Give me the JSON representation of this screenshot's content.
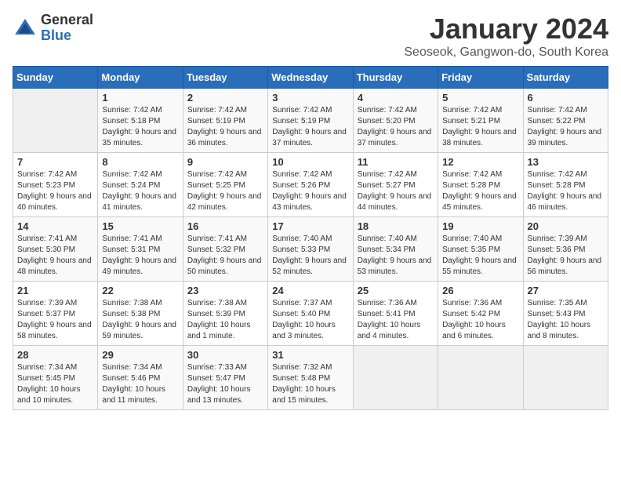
{
  "header": {
    "logo_general": "General",
    "logo_blue": "Blue",
    "month_title": "January 2024",
    "subtitle": "Seoseok, Gangwon-do, South Korea"
  },
  "days_of_week": [
    "Sunday",
    "Monday",
    "Tuesday",
    "Wednesday",
    "Thursday",
    "Friday",
    "Saturday"
  ],
  "weeks": [
    [
      {
        "day": "",
        "sunrise": "",
        "sunset": "",
        "daylight": "",
        "empty": true
      },
      {
        "day": "1",
        "sunrise": "Sunrise: 7:42 AM",
        "sunset": "Sunset: 5:18 PM",
        "daylight": "Daylight: 9 hours and 35 minutes."
      },
      {
        "day": "2",
        "sunrise": "Sunrise: 7:42 AM",
        "sunset": "Sunset: 5:19 PM",
        "daylight": "Daylight: 9 hours and 36 minutes."
      },
      {
        "day": "3",
        "sunrise": "Sunrise: 7:42 AM",
        "sunset": "Sunset: 5:19 PM",
        "daylight": "Daylight: 9 hours and 37 minutes."
      },
      {
        "day": "4",
        "sunrise": "Sunrise: 7:42 AM",
        "sunset": "Sunset: 5:20 PM",
        "daylight": "Daylight: 9 hours and 37 minutes."
      },
      {
        "day": "5",
        "sunrise": "Sunrise: 7:42 AM",
        "sunset": "Sunset: 5:21 PM",
        "daylight": "Daylight: 9 hours and 38 minutes."
      },
      {
        "day": "6",
        "sunrise": "Sunrise: 7:42 AM",
        "sunset": "Sunset: 5:22 PM",
        "daylight": "Daylight: 9 hours and 39 minutes."
      }
    ],
    [
      {
        "day": "7",
        "sunrise": "Sunrise: 7:42 AM",
        "sunset": "Sunset: 5:23 PM",
        "daylight": "Daylight: 9 hours and 40 minutes."
      },
      {
        "day": "8",
        "sunrise": "Sunrise: 7:42 AM",
        "sunset": "Sunset: 5:24 PM",
        "daylight": "Daylight: 9 hours and 41 minutes."
      },
      {
        "day": "9",
        "sunrise": "Sunrise: 7:42 AM",
        "sunset": "Sunset: 5:25 PM",
        "daylight": "Daylight: 9 hours and 42 minutes."
      },
      {
        "day": "10",
        "sunrise": "Sunrise: 7:42 AM",
        "sunset": "Sunset: 5:26 PM",
        "daylight": "Daylight: 9 hours and 43 minutes."
      },
      {
        "day": "11",
        "sunrise": "Sunrise: 7:42 AM",
        "sunset": "Sunset: 5:27 PM",
        "daylight": "Daylight: 9 hours and 44 minutes."
      },
      {
        "day": "12",
        "sunrise": "Sunrise: 7:42 AM",
        "sunset": "Sunset: 5:28 PM",
        "daylight": "Daylight: 9 hours and 45 minutes."
      },
      {
        "day": "13",
        "sunrise": "Sunrise: 7:42 AM",
        "sunset": "Sunset: 5:28 PM",
        "daylight": "Daylight: 9 hours and 46 minutes."
      }
    ],
    [
      {
        "day": "14",
        "sunrise": "Sunrise: 7:41 AM",
        "sunset": "Sunset: 5:30 PM",
        "daylight": "Daylight: 9 hours and 48 minutes."
      },
      {
        "day": "15",
        "sunrise": "Sunrise: 7:41 AM",
        "sunset": "Sunset: 5:31 PM",
        "daylight": "Daylight: 9 hours and 49 minutes."
      },
      {
        "day": "16",
        "sunrise": "Sunrise: 7:41 AM",
        "sunset": "Sunset: 5:32 PM",
        "daylight": "Daylight: 9 hours and 50 minutes."
      },
      {
        "day": "17",
        "sunrise": "Sunrise: 7:40 AM",
        "sunset": "Sunset: 5:33 PM",
        "daylight": "Daylight: 9 hours and 52 minutes."
      },
      {
        "day": "18",
        "sunrise": "Sunrise: 7:40 AM",
        "sunset": "Sunset: 5:34 PM",
        "daylight": "Daylight: 9 hours and 53 minutes."
      },
      {
        "day": "19",
        "sunrise": "Sunrise: 7:40 AM",
        "sunset": "Sunset: 5:35 PM",
        "daylight": "Daylight: 9 hours and 55 minutes."
      },
      {
        "day": "20",
        "sunrise": "Sunrise: 7:39 AM",
        "sunset": "Sunset: 5:36 PM",
        "daylight": "Daylight: 9 hours and 56 minutes."
      }
    ],
    [
      {
        "day": "21",
        "sunrise": "Sunrise: 7:39 AM",
        "sunset": "Sunset: 5:37 PM",
        "daylight": "Daylight: 9 hours and 58 minutes."
      },
      {
        "day": "22",
        "sunrise": "Sunrise: 7:38 AM",
        "sunset": "Sunset: 5:38 PM",
        "daylight": "Daylight: 9 hours and 59 minutes."
      },
      {
        "day": "23",
        "sunrise": "Sunrise: 7:38 AM",
        "sunset": "Sunset: 5:39 PM",
        "daylight": "Daylight: 10 hours and 1 minute."
      },
      {
        "day": "24",
        "sunrise": "Sunrise: 7:37 AM",
        "sunset": "Sunset: 5:40 PM",
        "daylight": "Daylight: 10 hours and 3 minutes."
      },
      {
        "day": "25",
        "sunrise": "Sunrise: 7:36 AM",
        "sunset": "Sunset: 5:41 PM",
        "daylight": "Daylight: 10 hours and 4 minutes."
      },
      {
        "day": "26",
        "sunrise": "Sunrise: 7:36 AM",
        "sunset": "Sunset: 5:42 PM",
        "daylight": "Daylight: 10 hours and 6 minutes."
      },
      {
        "day": "27",
        "sunrise": "Sunrise: 7:35 AM",
        "sunset": "Sunset: 5:43 PM",
        "daylight": "Daylight: 10 hours and 8 minutes."
      }
    ],
    [
      {
        "day": "28",
        "sunrise": "Sunrise: 7:34 AM",
        "sunset": "Sunset: 5:45 PM",
        "daylight": "Daylight: 10 hours and 10 minutes."
      },
      {
        "day": "29",
        "sunrise": "Sunrise: 7:34 AM",
        "sunset": "Sunset: 5:46 PM",
        "daylight": "Daylight: 10 hours and 11 minutes."
      },
      {
        "day": "30",
        "sunrise": "Sunrise: 7:33 AM",
        "sunset": "Sunset: 5:47 PM",
        "daylight": "Daylight: 10 hours and 13 minutes."
      },
      {
        "day": "31",
        "sunrise": "Sunrise: 7:32 AM",
        "sunset": "Sunset: 5:48 PM",
        "daylight": "Daylight: 10 hours and 15 minutes."
      },
      {
        "day": "",
        "sunrise": "",
        "sunset": "",
        "daylight": "",
        "empty": true
      },
      {
        "day": "",
        "sunrise": "",
        "sunset": "",
        "daylight": "",
        "empty": true
      },
      {
        "day": "",
        "sunrise": "",
        "sunset": "",
        "daylight": "",
        "empty": true
      }
    ]
  ]
}
